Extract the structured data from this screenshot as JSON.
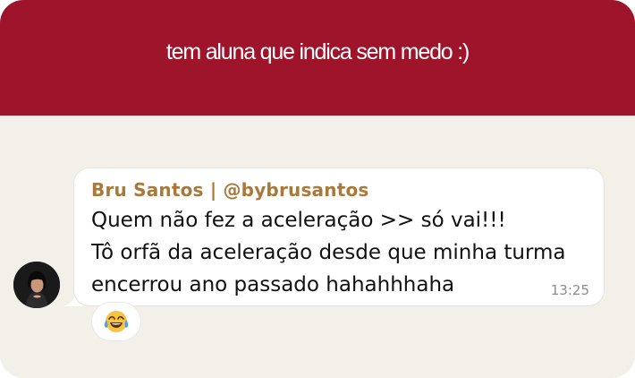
{
  "banner": {
    "text": "tem aluna que indica sem medo :)",
    "color": "#9e142b"
  },
  "message": {
    "sender": "Bru Santos | @bybrusantos",
    "lines": [
      "Quem não fez a aceleração >> só vai!!!",
      "Tô orfã da aceleração desde que minha turma",
      "encerrou ano passado hahahhhaha"
    ],
    "time": "13:25",
    "reaction_icon": "tears-of-joy-emoji"
  },
  "avatar": {
    "icon": "user-photo"
  },
  "colors": {
    "background": "#f3efe9",
    "sender": "#a8793a",
    "bubble": "#ffffff"
  }
}
